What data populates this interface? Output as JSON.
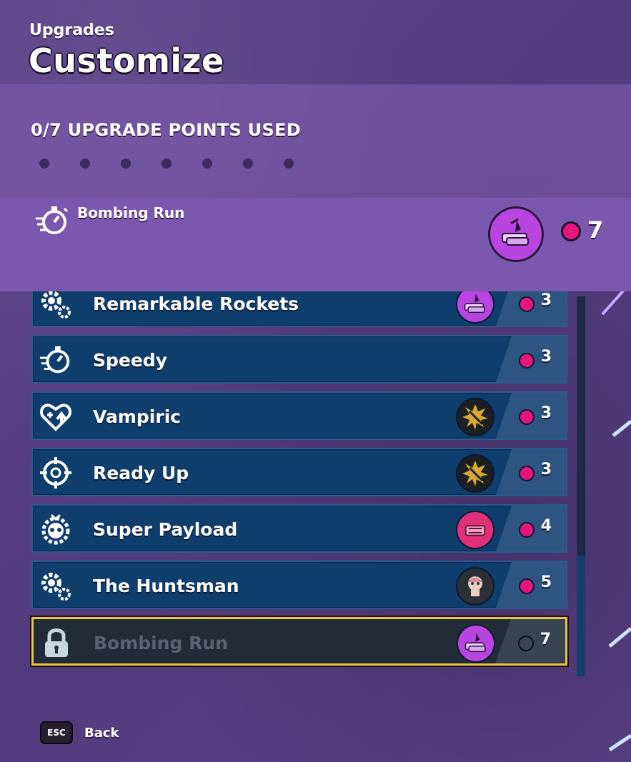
{
  "header": {
    "subtitle": "Upgrades",
    "title": "Customize"
  },
  "points": {
    "label": "0/7 UPGRADE POINTS USED",
    "used": 0,
    "total": 7
  },
  "selected": {
    "name": "Bombing Run",
    "cost": "7",
    "icon": "stopwatch-icon",
    "art": "rocket-mount-art"
  },
  "upgrades": [
    {
      "name": "Remarkable Rockets",
      "cost": "3",
      "icon": "gears-icon",
      "badge": "rocket-mount-art",
      "badge_color": "#b845e0",
      "locked": false
    },
    {
      "name": "Speedy",
      "cost": "3",
      "icon": "stopwatch-icon",
      "badge": "",
      "badge_color": "",
      "locked": false
    },
    {
      "name": "Vampiric",
      "cost": "3",
      "icon": "heart-plus-icon",
      "badge": "starburst-sword-icon",
      "badge_color": "#1b1f24",
      "locked": false
    },
    {
      "name": "Ready Up",
      "cost": "3",
      "icon": "crosshair-icon",
      "badge": "starburst-sword-icon",
      "badge_color": "#1b1f24",
      "locked": false
    },
    {
      "name": "Super Payload",
      "cost": "4",
      "icon": "skull-gear-icon",
      "badge": "payload-art",
      "badge_color": "#e0307a",
      "locked": false
    },
    {
      "name": "The Huntsman",
      "cost": "5",
      "icon": "gears-icon",
      "badge": "huntsman-portrait",
      "badge_color": "#2a2f36",
      "locked": false
    },
    {
      "name": "Bombing Run",
      "cost": "7",
      "icon": "lock-icon",
      "badge": "rocket-mount-art",
      "badge_color": "#b845e0",
      "locked": true
    }
  ],
  "footer": {
    "key": "ESC",
    "label": "Back"
  },
  "colors": {
    "point": "#e8147e",
    "row": "#0f3d6c",
    "locked_border": "#e7c44a",
    "panel": "#7a58b0"
  }
}
